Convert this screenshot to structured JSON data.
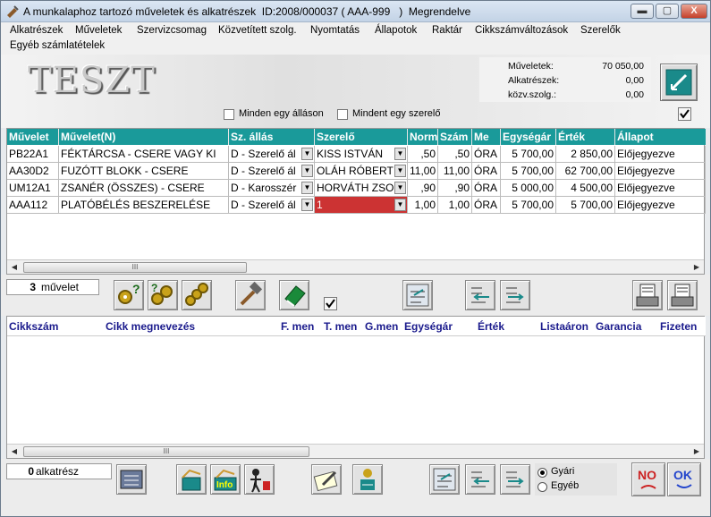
{
  "window": {
    "title": "A munkalaphoz tartozó műveletek és alkatrészek  ID:2008/000037 ( AAA-999   )  Megrendelve",
    "controls": {
      "minimize": "▬",
      "maximize": "▢",
      "close": "X"
    }
  },
  "menu": {
    "items": [
      "Alkatrészek",
      "Műveletek",
      "Szervizcsomag",
      "Közvetített szolg.",
      "Nyomtatás",
      "Állapotok",
      "Raktár",
      "Cikkszámváltozások",
      "Szerelők",
      "Egyéb számlatételek"
    ]
  },
  "logo_text": "TESZT",
  "summary": {
    "muveletek_label": "Műveletek:",
    "muveletek_value": "70 050,00",
    "alkatreszek_label": "Alkatrészek:",
    "alkatreszek_value": "0,00",
    "kozv_label": "közv.szolg.:",
    "kozv_value": "0,00"
  },
  "options": {
    "minden_egy_allason": "Minden egy álláson",
    "minden_egy_szerelo": "Mindent egy szerelő"
  },
  "operations": {
    "headers": [
      "Művelet",
      "Művelet(N)",
      "Sz. állás",
      "Szerelő",
      "Norm",
      "Szám",
      "Me",
      "Egységár",
      "Érték",
      "Állapot"
    ],
    "rows": [
      {
        "code": "PB22A1",
        "name": "FÉKTÁRCSA - CSERE VAGY KI",
        "allas": "D - Szerelő ál",
        "szerelo": "KISS ISTVÁN",
        "norm": ",50",
        "szam": ",50",
        "me": "ÓRA",
        "egysegar": "5 700,00",
        "ertek": "2 850,00",
        "allapot": "Előjegyezve"
      },
      {
        "code": "AA30D2",
        "name": "FUZÓTT BLOKK - CSERE",
        "allas": "D - Szerelő ál",
        "szerelo": "OLÁH RÓBERT",
        "norm": "11,00",
        "szam": "11,00",
        "me": "ÓRA",
        "egysegar": "5 700,00",
        "ertek": "62 700,00",
        "allapot": "Előjegyezve"
      },
      {
        "code": "UM12A1",
        "name": "ZSANÉR (ÖSSZES) - CSERE",
        "allas": "D - Karosszér",
        "szerelo": "HORVÁTH ZSO",
        "norm": ",90",
        "szam": ",90",
        "me": "ÓRA",
        "egysegar": "5 000,00",
        "ertek": "4 500,00",
        "allapot": "Előjegyezve"
      },
      {
        "code": "AAA112",
        "name": "PLATÓBÉLÉS BESZERELÉSE",
        "allas": "D - Szerelő ál",
        "szerelo": "1",
        "norm": "1,00",
        "szam": "1,00",
        "me": "ÓRA",
        "egysegar": "5 700,00",
        "ertek": "5 700,00",
        "allapot": "Előjegyezve"
      }
    ]
  },
  "op_count": {
    "value": "3",
    "label": "művelet"
  },
  "parts": {
    "headers": [
      "Cikkszám",
      "Cikk megnevezés",
      "F. men",
      "T. men",
      "G.men",
      "Egységár",
      "Érték",
      "Listaáron",
      "Garancia",
      "Fizeten"
    ]
  },
  "part_count": {
    "value": "0",
    "label": "alkatrész"
  },
  "radio": {
    "gyari": "Gyári",
    "egyeb": "Egyéb"
  },
  "buttons": {
    "no": "NO",
    "ok": "OK",
    "info": "Info"
  },
  "scroll_grip": "III",
  "colors": {
    "header_teal": "#1a9a9a",
    "no_red": "#cc2222",
    "ok_blue": "#2244cc"
  }
}
